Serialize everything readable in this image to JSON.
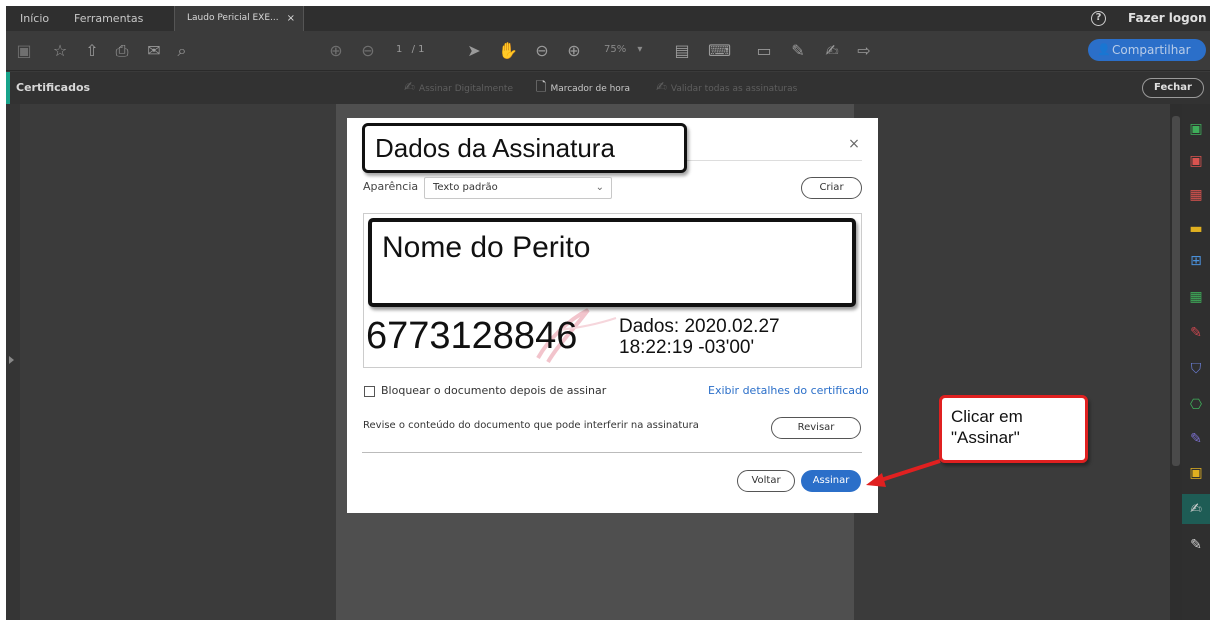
{
  "tabs": {
    "home": "Início",
    "tools": "Ferramentas",
    "document": "Laudo Pericial EXE...",
    "document_close": "×"
  },
  "header": {
    "help_icon": "?",
    "login": "Fazer logon"
  },
  "toolbar": {
    "page_current": "1",
    "page_total": "/ 1",
    "zoom": "75%",
    "zoom_chevron": "▾",
    "share": "Compartilhar",
    "icons": [
      "save-icon",
      "star-icon",
      "upload-icon",
      "print-icon",
      "email-icon",
      "search-icon",
      "page-up-icon",
      "page-down-icon",
      "select-cursor-icon",
      "hand-icon",
      "zoom-out-icon",
      "zoom-in-icon",
      "page-fit-icon",
      "keyboard-icon",
      "comment-icon",
      "pen-icon",
      "sign-icon",
      "share-link-icon"
    ]
  },
  "certbar": {
    "title": "Certificados",
    "sign_digitally": "Assinar Digitalmente",
    "timestamp": "Marcador de hora",
    "validate_all": "Validar todas as assinaturas",
    "close": "Fechar"
  },
  "dialog": {
    "title": "Dados da Assinatura",
    "close": "×",
    "appearance_label": "Aparência",
    "appearance_value": "Texto padrão",
    "create": "Criar",
    "preview_name": "Nome do Perito",
    "preview_id": "6773128846",
    "preview_date_line1": "Dados: 2020.02.27",
    "preview_date_line2": "18:22:19 -03'00'",
    "lock_label": "Bloquear o documento depois de assinar",
    "cert_details_link": "Exibir detalhes do certificado",
    "review_text": "Revise o conteúdo do documento que pode interferir na assinatura",
    "review_button": "Revisar",
    "back_button": "Voltar",
    "sign_button": "Assinar"
  },
  "callout": {
    "line1": "Clicar em",
    "line2": "\"Assinar\""
  },
  "colors": {
    "accent_blue": "#2b6fc9",
    "teal": "#18a38a",
    "callout_red": "#e02020"
  }
}
